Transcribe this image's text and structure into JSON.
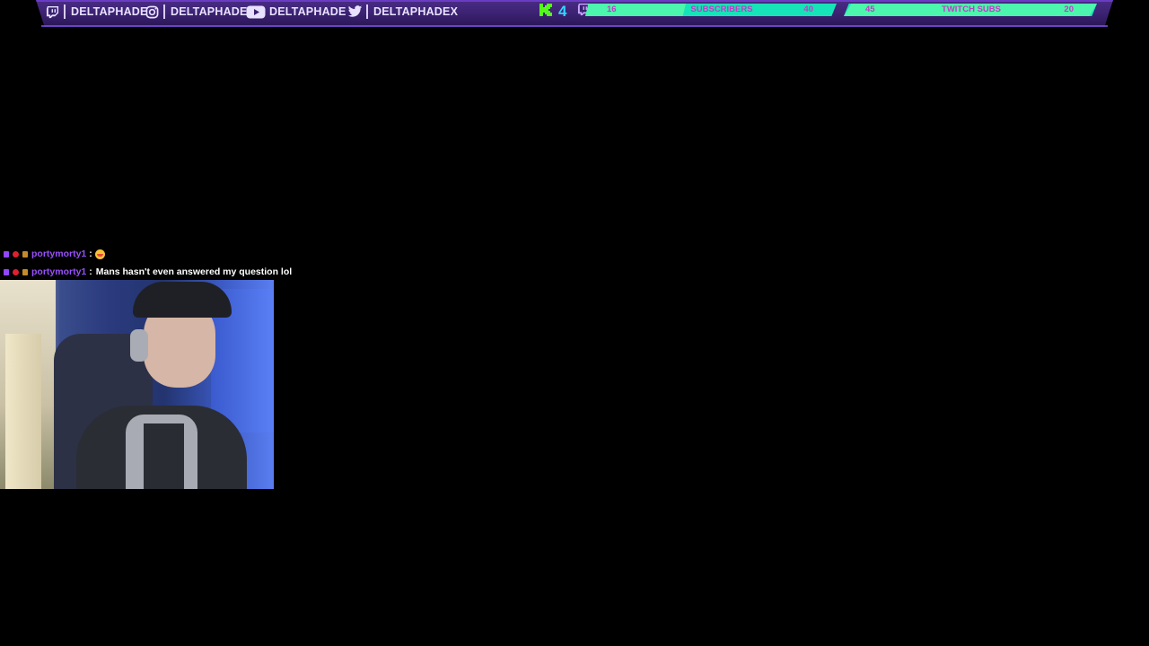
{
  "topbar": {
    "socials": [
      {
        "icon": "twitch-icon",
        "name": "DELTAPHADE"
      },
      {
        "icon": "instagram-icon",
        "name": "DELTAPHADE"
      },
      {
        "icon": "youtube-icon",
        "name": "DELTAPHADE"
      },
      {
        "icon": "twitter-icon",
        "name": "DELTAPHADEX"
      }
    ],
    "counters": [
      {
        "icon": "kick-icon",
        "value": "4"
      },
      {
        "icon": "twitch-viewers-icon",
        "value": "4"
      }
    ],
    "goals": [
      {
        "label": "SUBSCRIBERS",
        "current": "16",
        "target": "40",
        "progress": 0.4
      },
      {
        "label": "TWITCH SUBS",
        "current": "45",
        "target": "20",
        "progress": 1.0
      }
    ],
    "colors": {
      "accent": "#2fd6ff",
      "goal_bar": "#17e3b8",
      "goal_text": "#c23cc6",
      "plate": "#3a2170"
    }
  },
  "chat": {
    "messages": [
      {
        "user": "portymorty1",
        "sep": ":",
        "text": "",
        "emoji": "grinning-face"
      },
      {
        "user": "portymorty1",
        "sep": ":",
        "text": "Mans hasn't even answered my question lol"
      }
    ],
    "colors": {
      "username": "#9a4fff"
    }
  },
  "webcam": {
    "description_icon": "webcam-feed"
  }
}
